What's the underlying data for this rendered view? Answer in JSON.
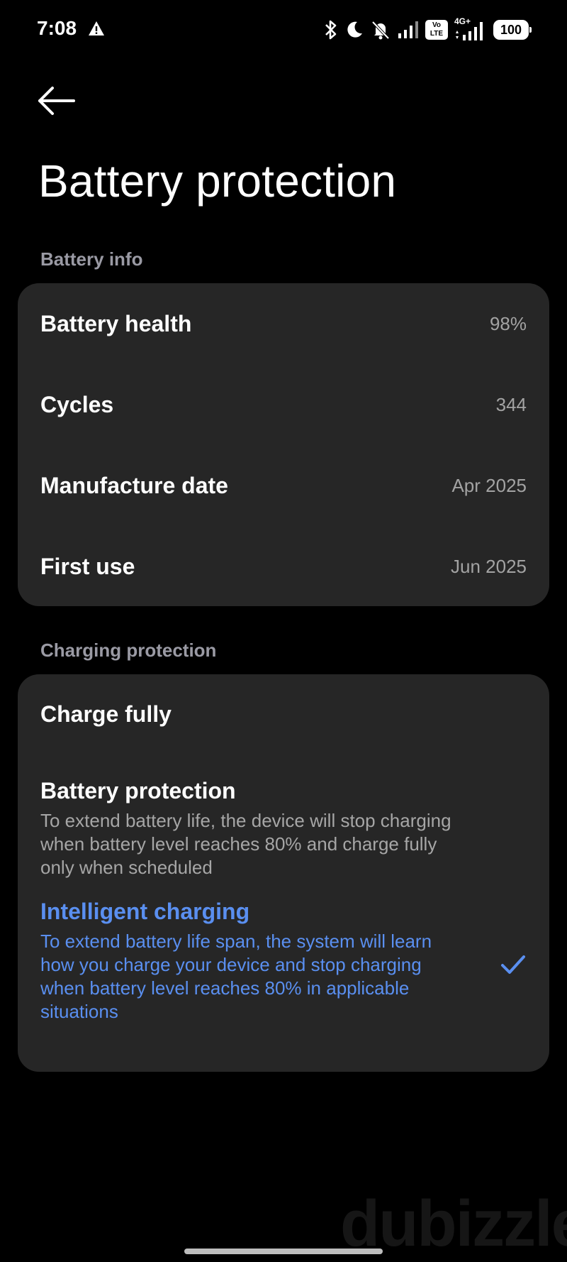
{
  "status_bar": {
    "time": "7:08",
    "volte_top": "Vo",
    "volte_bottom": "LTE",
    "network_type": "4G+",
    "battery_level": "100"
  },
  "page": {
    "title": "Battery protection"
  },
  "battery_info": {
    "header": "Battery info",
    "rows": [
      {
        "label": "Battery health",
        "value": "98%"
      },
      {
        "label": "Cycles",
        "value": "344"
      },
      {
        "label": "Manufacture date",
        "value": "Apr 2025"
      },
      {
        "label": "First use",
        "value": "Jun 2025"
      }
    ]
  },
  "charging_protection": {
    "header": "Charging protection",
    "options": [
      {
        "title": "Charge fully",
        "description": "",
        "selected": false
      },
      {
        "title": "Battery protection",
        "description": "To extend battery life, the device will stop charging when battery level reaches 80% and charge fully only when scheduled",
        "selected": false
      },
      {
        "title": "Intelligent charging",
        "description": "To extend battery life span, the system will learn how you charge your device and stop charging when battery level reaches 80% in applicable situations",
        "selected": true
      }
    ]
  },
  "watermark": "dubizzle",
  "colors": {
    "accent": "#5a8ff0",
    "card": "#262626",
    "background": "#000000"
  }
}
